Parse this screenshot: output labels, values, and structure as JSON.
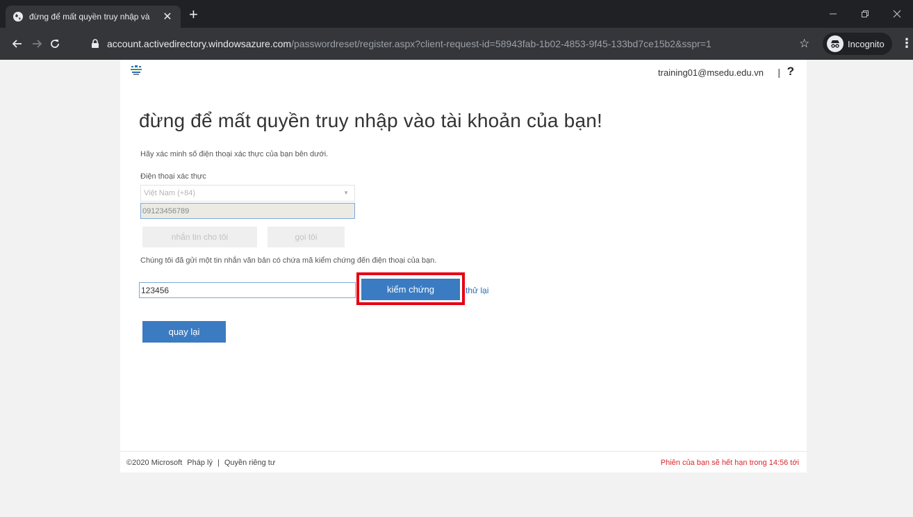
{
  "browser": {
    "tab_title": "đừng để mất quyền truy nhập và",
    "new_tab": "+",
    "url_host": "account.activedirectory.windowsazure.com",
    "url_path": "/passwordreset/register.aspx?client-request-id=58943fab-1b02-4853-9f45-133bd7ce15b2&sspr=1",
    "profile_label": "Incognito"
  },
  "header": {
    "user_email": "training01@msedu.edu.vn",
    "separator": "|",
    "help": "?"
  },
  "main": {
    "heading": "đừng để mất quyền truy nhập vào tài khoản của bạn!",
    "instructions": "Hãy xác minh số điện thoại xác thực của bạn bên dưới.",
    "phone_label": "Điện thoại xác thực",
    "country_value": "Việt Nam (+84)",
    "phone_value": "09123456789",
    "text_me_button": "nhắn tin cho tôi",
    "call_me_button": "gọi tôi",
    "sent_message": "Chúng tôi đã gửi một tin nhắn văn bản có chứa mã kiểm chứng đến điện thoại của bạn.",
    "code_value": "123456",
    "verify_button": "kiểm chứng",
    "retry_link": "thử lại",
    "back_button": "quay lại"
  },
  "footer": {
    "copyright": "©2020 Microsoft",
    "legal": "Pháp lý",
    "separator": "|",
    "privacy": "Quyền riêng tư",
    "session": "Phiên của bạn sẽ hết hạn trong 14:56 tới"
  },
  "colors": {
    "accent": "#3b7bc2",
    "highlight": "#e60012",
    "session_warning": "#d9272e"
  }
}
